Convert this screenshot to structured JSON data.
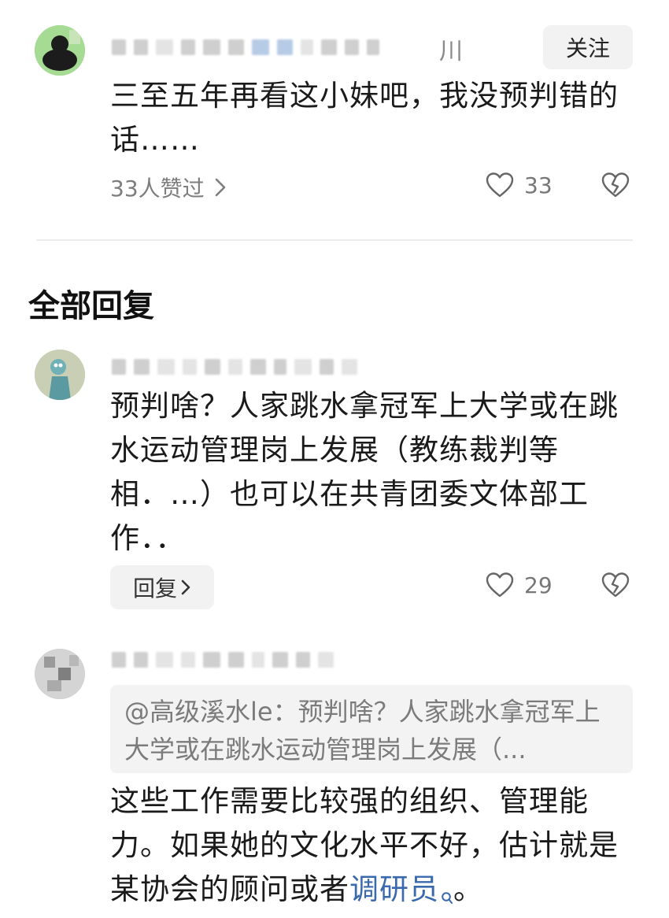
{
  "comment": {
    "username_suffix": "川",
    "follow_label": "关注",
    "text": "三至五年再看这小妹吧，我没预判错的话……",
    "likes_summary": "33人赞过",
    "like_count": "33"
  },
  "section_title": "全部回复",
  "reply1": {
    "text": "预判啥？人家跳水拿冠军上大学或在跳水运动管理岗上发展（教练裁判等相．…）也可以在共青团委文体部工作．．",
    "reply_label": "回复",
    "like_count": "29"
  },
  "reply2": {
    "quote": "@高级溪水le：预判啥？人家跳水拿冠军上大学或在跳水运动管理岗上发展（...",
    "text_before_link": "这些工作需要比较强的组织、管理能力。如果她的文化水平不好，估计就是某协会的顾问或者",
    "link_text": "调研员",
    "text_after_link": "。"
  },
  "icons": {
    "like": "heart-outline-icon",
    "dislike": "broken-heart-icon",
    "chevron": "chevron-right-icon",
    "search": "search-icon"
  },
  "colors": {
    "link": "#3a6aad",
    "button_bg": "#f2f2f2",
    "quote_bg": "#f3f3f3"
  }
}
